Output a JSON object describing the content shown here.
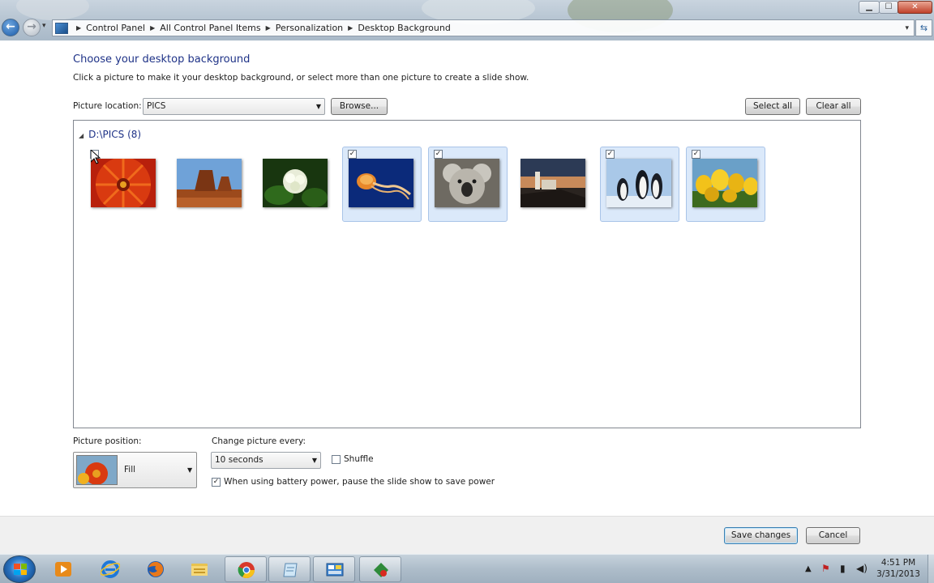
{
  "window": {
    "controls": {
      "minimize": "▁",
      "maximize": "☐",
      "close": "✕"
    }
  },
  "nav": {
    "back": "←",
    "forward": "→",
    "recent": "▾",
    "refresh": "⇆",
    "address_dropdown": "▾"
  },
  "breadcrumb": [
    "Control Panel",
    "All Control Panel Items",
    "Personalization",
    "Desktop Background"
  ],
  "page": {
    "heading": "Choose your desktop background",
    "instructions": "Click a picture to make it your desktop background, or select more than one picture to create a slide show."
  },
  "picture_location": {
    "label": "Picture location:",
    "value": "PICS",
    "browse": "Browse..."
  },
  "selection_buttons": {
    "select_all": "Select all",
    "clear_all": "Clear all"
  },
  "picture_group": {
    "name": "D:\\PICS (8)"
  },
  "pictures": [
    {
      "subject": "chrysanthemum",
      "checked": false,
      "state": "hover"
    },
    {
      "subject": "desert",
      "checked": false,
      "state": "none"
    },
    {
      "subject": "hydrangeas",
      "checked": false,
      "state": "none"
    },
    {
      "subject": "jellyfish",
      "checked": true,
      "state": "selected"
    },
    {
      "subject": "koala",
      "checked": true,
      "state": "selected"
    },
    {
      "subject": "lighthouse",
      "checked": false,
      "state": "none"
    },
    {
      "subject": "penguins",
      "checked": true,
      "state": "selected"
    },
    {
      "subject": "tulips",
      "checked": true,
      "state": "selected"
    }
  ],
  "picture_position": {
    "label": "Picture position:",
    "value": "Fill"
  },
  "change_interval": {
    "label": "Change picture every:",
    "value": "10 seconds"
  },
  "shuffle": {
    "label": "Shuffle",
    "checked": false
  },
  "battery": {
    "label": "When using battery power, pause the slide show to save power",
    "checked": true
  },
  "actions": {
    "save": "Save changes",
    "cancel": "Cancel"
  },
  "taskbar": {
    "items": [
      {
        "name": "media-player",
        "active": false
      },
      {
        "name": "internet-explorer",
        "active": false
      },
      {
        "name": "firefox",
        "active": false
      },
      {
        "name": "explorer",
        "active": false
      },
      {
        "name": "chrome",
        "active": true
      },
      {
        "name": "notepad",
        "active": true
      },
      {
        "name": "control-panel",
        "active": true
      },
      {
        "name": "camtasia",
        "active": true
      }
    ],
    "time": "4:51 PM",
    "date": "3/31/2013"
  }
}
